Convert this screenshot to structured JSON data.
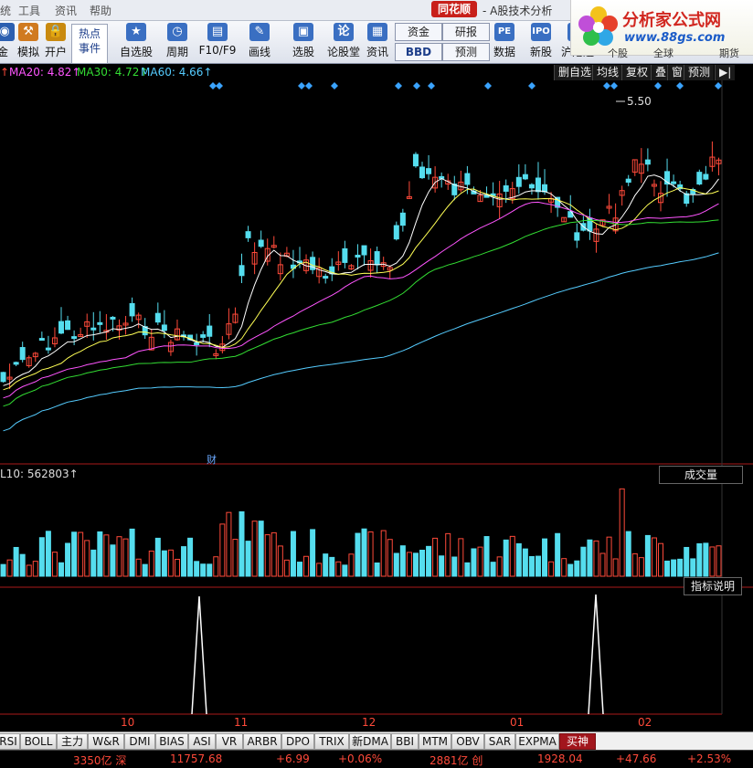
{
  "menu": {
    "items": [
      "统",
      "工具",
      "资讯",
      "帮助"
    ]
  },
  "title_bar": {
    "brand": "同花顺",
    "title": "- A股技术分析"
  },
  "logo": {
    "site_name": "分析家公式网",
    "url": "www.88gs.com"
  },
  "toolbar": {
    "buttons": [
      {
        "label": "金",
        "icon": "gold-icon"
      },
      {
        "label": "模拟",
        "icon": "hammer-icon"
      },
      {
        "label": "开户",
        "icon": "lock-icon"
      },
      {
        "label": "自选股",
        "icon": "star-icon"
      },
      {
        "label": "周期",
        "icon": "clock-icon"
      },
      {
        "label": "F10/F9",
        "icon": "f10-icon"
      },
      {
        "label": "画线",
        "icon": "pen-icon"
      },
      {
        "label": "选股",
        "icon": "screen-icon"
      },
      {
        "label": "论股堂",
        "icon": "talk-icon"
      },
      {
        "label": "资讯",
        "icon": "news-icon"
      },
      {
        "label": "数据",
        "icon": "pe-icon"
      },
      {
        "label": "新股",
        "icon": "ipo-icon"
      },
      {
        "label": "沪港通",
        "icon": "hk-icon"
      }
    ],
    "hot_event": "热点\n事件",
    "capital": "资金",
    "bbd": "BBD",
    "research": "研报",
    "forecast": "预测",
    "peek": [
      "个股",
      "全球",
      "期货"
    ]
  },
  "ma_bar": {
    "ma20": "MA20: 4.82↑",
    "ma30": "MA30: 4.72↑",
    "ma60": "MA60: 4.66↑",
    "ma_colors": {
      "ma20": "#ff55ff",
      "ma30": "#33dd33",
      "ma60": "#55ccff"
    }
  },
  "top_buttons": [
    "删自选",
    "均线",
    "复权",
    "叠",
    "窗",
    "预测",
    "▶|"
  ],
  "price_marker": "5.50",
  "finance_marker": "财",
  "volume": {
    "label": "L10: 562803↑",
    "badge": "成交量"
  },
  "indicator": {
    "badge": "指标说明"
  },
  "x_axis": {
    "labels": [
      "10",
      "11",
      "12",
      "01",
      "02"
    ]
  },
  "tabs": [
    "RSI",
    "BOLL",
    "主力",
    "W&R",
    "DMI",
    "BIAS",
    "ASI",
    "VR",
    "ARBR",
    "DPO",
    "TRIX",
    "新DMA",
    "BBI",
    "MTM",
    "OBV",
    "SAR",
    "EXPMA",
    "买神"
  ],
  "active_tab": "买神",
  "status": [
    "3350亿 深",
    "11757.68",
    "+6.99",
    "+0.06%",
    "2881亿 创",
    "1928.04",
    "+47.66",
    "+2.53%"
  ],
  "colors": {
    "up": "#ff4a3a",
    "down": "#55ddee",
    "accent": "#a2161d"
  }
}
